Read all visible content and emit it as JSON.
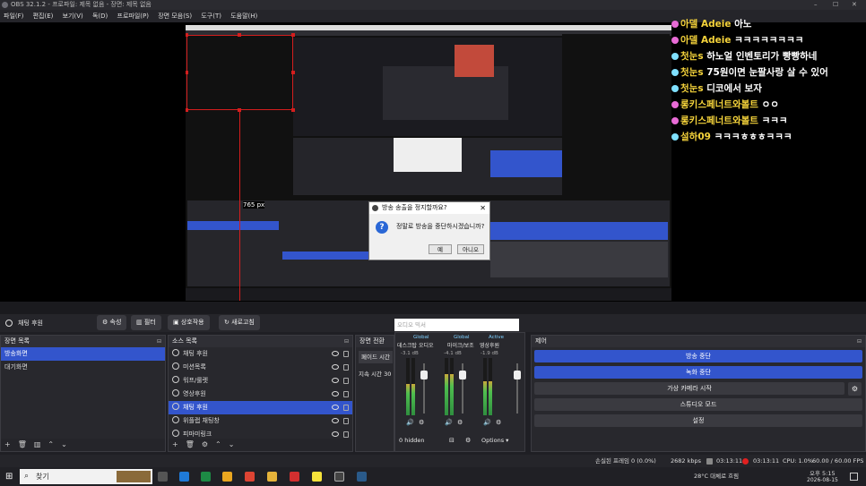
{
  "window": {
    "title": "OBS 32.1.2 - 프로파일: 제목 없음 - 장면: 제목 없음"
  },
  "menu": [
    "파일(F)",
    "편집(E)",
    "보기(V)",
    "독(D)",
    "프로파일(P)",
    "장면 모음(S)",
    "도구(T)",
    "도움말(H)"
  ],
  "chat": [
    {
      "name": "",
      "msg": ""
    },
    {
      "name": "아델 Adeie",
      "msg": "아노",
      "icon": "heart-icon"
    },
    {
      "name": "아델 Adeie",
      "msg": "ㅋㅋㅋㅋㅋㅋㅋㅋ",
      "icon": "heart-icon"
    },
    {
      "name": "첫눈s",
      "msg": "하노얼 인벤토리가 빵빵하네",
      "icon": "leaf-icon"
    },
    {
      "name": "첫눈s",
      "msg": "75원이면 눈팔사랑 살 수 있어",
      "icon": "leaf-icon"
    },
    {
      "name": "첫눈s",
      "msg": "디코에서 보자",
      "icon": "leaf-icon"
    },
    {
      "name": "롱키스페너트와볼트",
      "msg": "ㅇㅇ",
      "icon": "heart-icon"
    },
    {
      "name": "롱키스페너트와볼트",
      "msg": "ㅋㅋㅋ",
      "icon": "heart-icon"
    },
    {
      "name": "설하09",
      "msg": "ㅋㅋㅋㅎㅎㅎㅋㅋㅋ",
      "icon": "leaf-icon"
    }
  ],
  "dialog": {
    "title": "방송 송출을 정지할까요?",
    "message": "정말로 방송을 중단하시겠습니까?",
    "yes": "예",
    "no": "아니오"
  },
  "preview_label": "765 px",
  "scenebar": {
    "current_source": "채팅 후원",
    "buttons": [
      "속성",
      "필터",
      "상호작용",
      "새로고침"
    ]
  },
  "scenes": {
    "title": "장면 목록",
    "items": [
      "방송화면",
      "대기화면"
    ]
  },
  "sources": {
    "title": "소스 목록",
    "items": [
      "채팅 후원",
      "미션목록",
      "워프/룰렛",
      "영상후원",
      "채팅 후원",
      "위플랩 채팅창",
      "피마미링크"
    ],
    "selected_index": 4
  },
  "transitions": {
    "title": "장면 전환",
    "label1": "페이드 시간",
    "label2": "지속 시간",
    "value2": "30"
  },
  "mixer": {
    "search_placeholder": "오디오 믹서",
    "channels": [
      {
        "scope": "Global",
        "name": "데스크탑 오디오",
        "db": "-3.1 dB",
        "level": 0.55
      },
      {
        "scope": "Global",
        "name": "마이크/보조",
        "db": "-4.1 dB",
        "level": 0.72
      },
      {
        "scope": "Active",
        "name": "영상후원",
        "db": "-1.9 dB",
        "level": 0.6
      }
    ],
    "hidden_label": "0 hidden",
    "options_label": "Options"
  },
  "controls": {
    "title": "제어",
    "buttons": [
      {
        "label": "방송 중단",
        "active": true
      },
      {
        "label": "녹화 중단",
        "active": true
      },
      {
        "label": "가상 카메라 시작",
        "active": false
      },
      {
        "label": "스튜디오 모드",
        "active": false
      },
      {
        "label": "설정",
        "active": false
      }
    ]
  },
  "statusbar": {
    "dropped": "손실된 프레임 0 (0.0%)",
    "bitrate": "2682 kbps",
    "stream_time": "03:13:11",
    "record_time": "03:13:11",
    "cpu": "CPU: 1.0%",
    "fps": "60.00 / 60.00 FPS"
  },
  "taskbar": {
    "search": "찾기",
    "weather": "28°C 대체로 흐림",
    "time": "오후 5:15",
    "date": "2026-08-15"
  },
  "colors": {
    "accent": "#3355cc",
    "selection": "#d41e1e",
    "chat_name": "#f5d33b"
  }
}
